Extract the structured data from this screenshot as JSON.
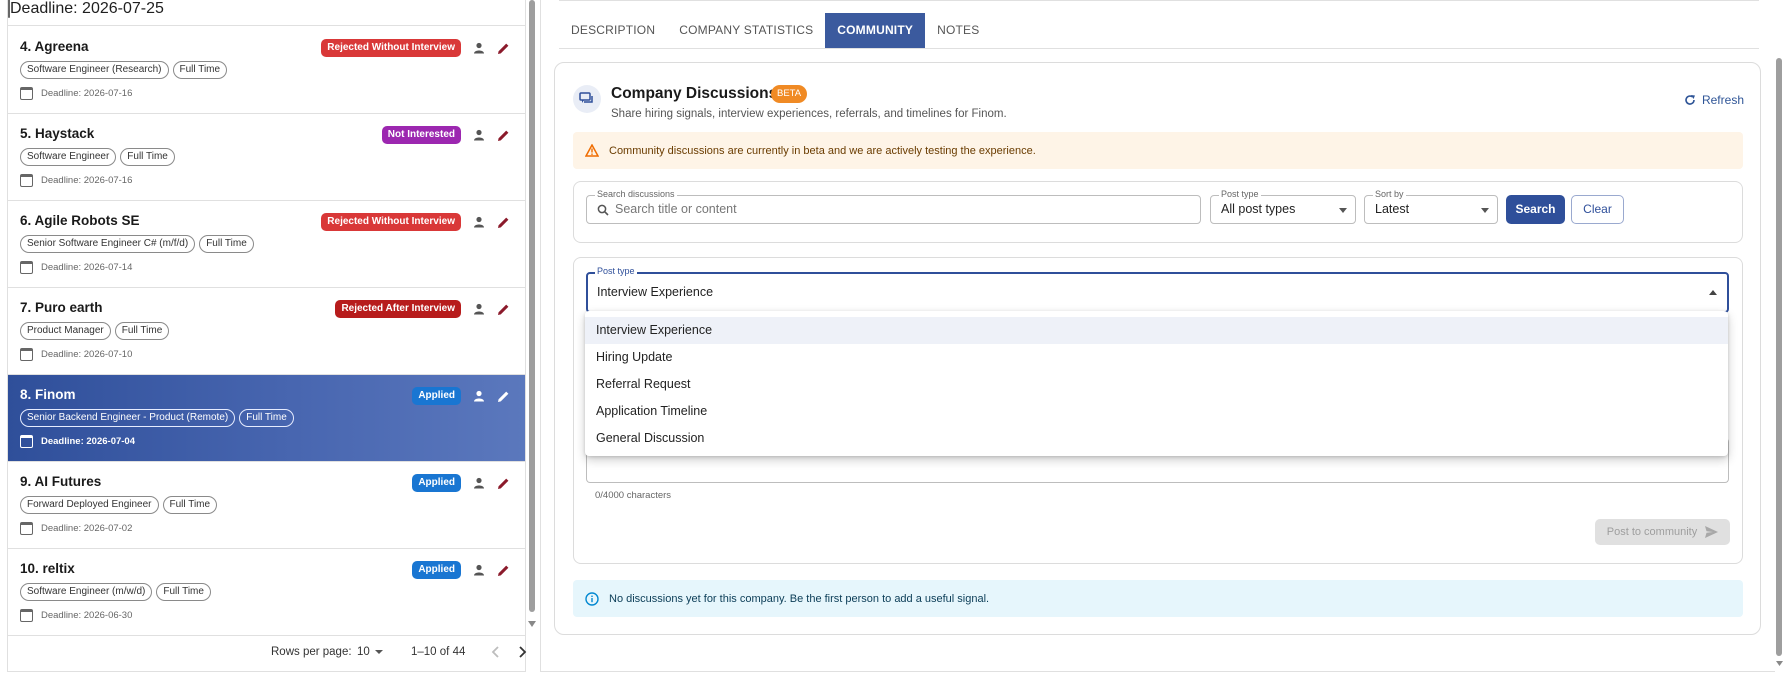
{
  "job_list": {
    "top_stub_deadline": "Deadline: 2026-07-25",
    "rows": [
      {
        "title": "4. Agreena",
        "chips": [
          "Software Engineer (Research)",
          "Full Time"
        ],
        "status": "Rejected Without Interview",
        "deadline": "Deadline: 2026-07-16"
      },
      {
        "title": "5. Haystack",
        "chips": [
          "Software Engineer",
          "Full Time"
        ],
        "status": "Not Interested",
        "deadline": "Deadline: 2026-07-16"
      },
      {
        "title": "6. Agile Robots SE",
        "chips": [
          "Senior Software Engineer C# (m/f/d)",
          "Full Time"
        ],
        "status": "Rejected Without Interview",
        "deadline": "Deadline: 2026-07-14"
      },
      {
        "title": "7. Puro earth",
        "chips": [
          "Product Manager",
          "Full Time"
        ],
        "status": "Rejected After Interview",
        "deadline": "Deadline: 2026-07-10"
      },
      {
        "title": "8. Finom",
        "chips": [
          "Senior Backend Engineer - Product (Remote)",
          "Full Time"
        ],
        "status": "Applied",
        "deadline": "Deadline: 2026-07-04"
      },
      {
        "title": "9. AI Futures",
        "chips": [
          "Forward Deployed Engineer",
          "Full Time"
        ],
        "status": "Applied",
        "deadline": "Deadline: 2026-07-02"
      },
      {
        "title": "10. reltix",
        "chips": [
          "Software Engineer (m/w/d)",
          "Full Time"
        ],
        "status": "Applied",
        "deadline": "Deadline: 2026-06-30"
      }
    ],
    "status_colors": {
      "Rejected Without Interview": "#d93838",
      "Not Interested": "#9c27b0",
      "Rejected After Interview": "#b71c1c",
      "Applied": "#1976d2"
    },
    "selected_index": 4
  },
  "pagination": {
    "rows_per_page_label": "Rows per page:",
    "rows_per_page_value": "10",
    "range": "1–10 of 44"
  },
  "tabs": [
    {
      "label": "DESCRIPTION"
    },
    {
      "label": "COMPANY STATISTICS"
    },
    {
      "label": "COMMUNITY"
    },
    {
      "label": "NOTES"
    }
  ],
  "active_tab": "COMMUNITY",
  "discussions": {
    "title": "Company Discussions",
    "beta_label": "BETA",
    "subtitle": "Share hiring signals, interview experiences, referrals, and timelines for Finom.",
    "refresh_label": "Refresh",
    "warning": "Community discussions are currently in beta and we are actively testing the experience.",
    "filters": {
      "search_label": "Search discussions",
      "search_placeholder": "Search title or content",
      "post_type_label": "Post type",
      "post_type_value": "All post types",
      "sort_label": "Sort by",
      "sort_value": "Latest",
      "search_button": "Search",
      "clear_button": "Clear"
    },
    "compose": {
      "post_type_label": "Post type",
      "post_type_value": "Interview Experience",
      "char_count": "0/4000 characters",
      "post_button": "Post to community"
    },
    "post_type_options": [
      "Interview Experience",
      "Hiring Update",
      "Referral Request",
      "Application Timeline",
      "General Discussion"
    ],
    "empty_message": "No discussions yet for this company. Be the first person to add a useful signal."
  },
  "colors": {
    "accent": "#2f4f9a",
    "beta": "#f08a24",
    "warning_bg": "#fef4e7",
    "info_bg": "#e6f6fc"
  }
}
